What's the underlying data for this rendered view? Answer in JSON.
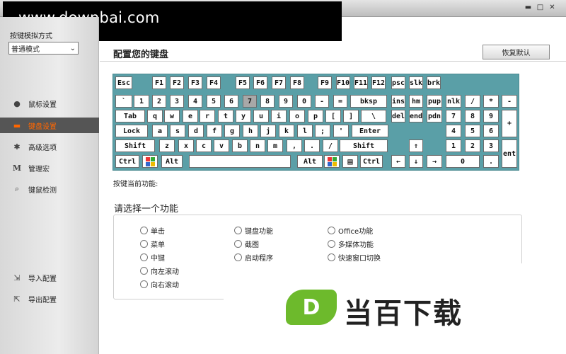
{
  "watermark": "www.downbai.com",
  "window_controls": {
    "minimize": "▬",
    "maximize": "□",
    "close": "✕"
  },
  "sidebar": {
    "mode_label": "按键模拟方式",
    "mode_value": "普通模式",
    "items": [
      {
        "label": "鼠标设置",
        "icon": "mouse-icon"
      },
      {
        "label": "键盘设置",
        "icon": "keyboard-icon"
      },
      {
        "label": "高级选项",
        "icon": "gear-icon"
      },
      {
        "label": "管理宏",
        "icon": "macro-icon"
      },
      {
        "label": "键鼠检测",
        "icon": "detect-icon"
      },
      {
        "label": "导入配置",
        "icon": "import-icon"
      },
      {
        "label": "导出配置",
        "icon": "export-icon"
      }
    ]
  },
  "header": {
    "title": "配置您的键盘",
    "restore_label": "恢复默认"
  },
  "keyboard": {
    "selected_key": "7",
    "win_icon": "windows-logo-icon",
    "menu_icon": "menu-key-icon",
    "rows": {
      "fn": [
        "Esc",
        "F1",
        "F2",
        "F3",
        "F4",
        "F5",
        "F6",
        "F7",
        "F8",
        "F9",
        "F10",
        "F11",
        "F12",
        "psc",
        "slk",
        "brk"
      ],
      "num": [
        "`",
        "1",
        "2",
        "3",
        "4",
        "5",
        "6",
        "7",
        "8",
        "9",
        "0",
        "-",
        "=",
        "bksp",
        "ins",
        "hm",
        "pup",
        "nlk",
        "/",
        "*",
        "-"
      ],
      "tab": [
        "Tab",
        "q",
        "w",
        "e",
        "r",
        "t",
        "y",
        "u",
        "i",
        "o",
        "p",
        "[",
        "]",
        "\\",
        "del",
        "end",
        "pdn",
        "7",
        "8",
        "9",
        "+"
      ],
      "caps": [
        "Lock",
        "a",
        "s",
        "d",
        "f",
        "g",
        "h",
        "j",
        "k",
        "l",
        ";",
        "'",
        "Enter",
        "4",
        "5",
        "6"
      ],
      "shift": [
        "Shift",
        "z",
        "x",
        "c",
        "v",
        "b",
        "n",
        "m",
        ",",
        ".",
        "/",
        "Shift",
        "↑",
        "1",
        "2",
        "3",
        "ent"
      ],
      "ctrl": [
        "Ctrl",
        "",
        "Alt",
        "",
        "Alt",
        "",
        "",
        "Ctrl",
        "←",
        "↓",
        "→",
        "0",
        "."
      ]
    }
  },
  "current_function_label": "按键当前功能:",
  "choose_label": "请选择一个功能",
  "options": [
    "单击",
    "菜单",
    "中键",
    "向左滚动",
    "向右滚动",
    "键盘功能",
    "截图",
    "启动程序",
    "Office功能",
    "多媒体功能",
    "快速窗口切换"
  ],
  "brand": {
    "logo_letter": "D",
    "name": "当百下载"
  }
}
